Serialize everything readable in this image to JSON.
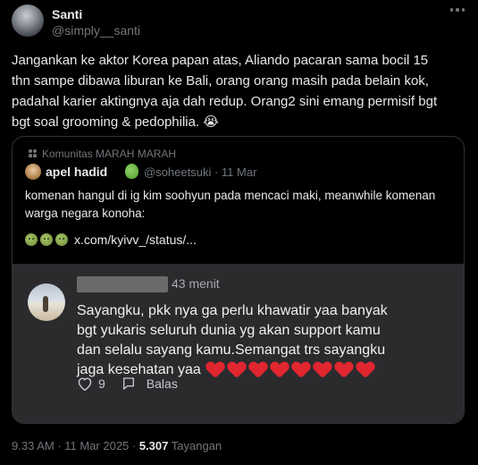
{
  "tweet": {
    "author_name": "Santi",
    "author_handle": "@simply__santi",
    "text": "Jangankan ke aktor Korea papan atas, Aliando pacaran sama bocil 15\nthn sampe dibawa liburan ke Bali, orang orang masih pada belain kok,\npadahal karier aktingnya aja dah redup. Orang2 sini emang permisif bgt\nbgt soal grooming & pedophilia. 😭",
    "date": "9.33 AM · 11 Mar 2025 · ",
    "views": "5.307",
    "views_label": " Tayangan"
  },
  "quote": {
    "community": "Komunitas MARAH MARAH",
    "author_name": "apel hadid",
    "author_handle": "@soheetsuki · 11 Mar",
    "text": "komenan hangul di ig kim soohyun pada mencaci maki, meanwhile komenan\nwarga negara konoha:",
    "link": "x.com/kyivv_/status/...",
    "comment": {
      "time": "43 menit",
      "text": "Sayangku, pkk nya ga perlu khawatir yaa banyak\nbgt yukaris seluruh dunia yg akan support kamu\ndan selalu sayang kamu.Semangat trs sayangku\njaga kesehatan yaa",
      "likes": "9",
      "reply_label": "Balas"
    }
  },
  "colors": {
    "background": "#000000",
    "comment_bg": "#2b2b2e",
    "heart": "#e0262f",
    "muted": "#71767b"
  }
}
